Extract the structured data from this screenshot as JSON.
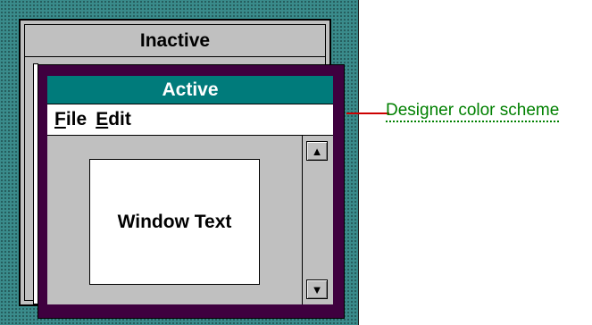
{
  "preview": {
    "inactive_title": "Inactive",
    "active_title": "Active",
    "menu": [
      {
        "mnemonic": "F",
        "rest": "ile"
      },
      {
        "mnemonic": "E",
        "rest": "dit"
      }
    ],
    "window_text": "Window Text",
    "scroll_up_glyph": "▲",
    "scroll_down_glyph": "▼"
  },
  "annotation": {
    "label": "Designer color scheme"
  },
  "colors": {
    "desktop": "#3a8b8b",
    "active_border": "#3f003f",
    "active_title_bar": "#007b7b",
    "inactive_title_bar": "#c0c0c0",
    "window_background": "#ffffff",
    "leader_line": "#cc0000",
    "annotation_text": "#008000"
  }
}
